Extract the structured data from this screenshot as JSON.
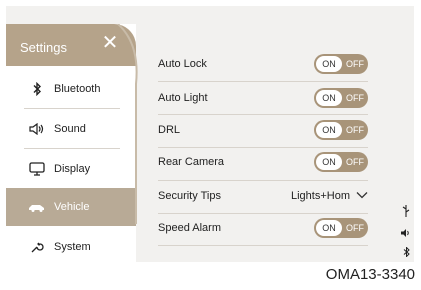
{
  "sidebar": {
    "title": "Settings",
    "close_icon": "close-icon",
    "items": [
      {
        "label": "Bluetooth",
        "icon": "bluetooth-icon"
      },
      {
        "label": "Sound",
        "icon": "speaker-icon"
      },
      {
        "label": "Display",
        "icon": "monitor-icon"
      },
      {
        "label": "Vehicle",
        "icon": "car-icon",
        "active": true
      },
      {
        "label": "System",
        "icon": "wrench-icon"
      }
    ]
  },
  "settings": {
    "rows": [
      {
        "label": "Auto Lock",
        "on": "ON",
        "off": "OFF"
      },
      {
        "label": "Auto Light",
        "on": "ON",
        "off": "OFF"
      },
      {
        "label": "DRL",
        "on": "ON",
        "off": "OFF"
      },
      {
        "label": "Rear Camera",
        "on": "ON",
        "off": "OFF"
      },
      {
        "label": "Security Tips",
        "value": "Lights+Hom"
      },
      {
        "label": "Speed Alarm",
        "on": "ON",
        "off": "OFF"
      }
    ]
  },
  "caption": "OMA13-3340",
  "colors": {
    "accent": "#b5a38a",
    "active_bg": "#b8aa96",
    "background": "#f2f1ef"
  }
}
